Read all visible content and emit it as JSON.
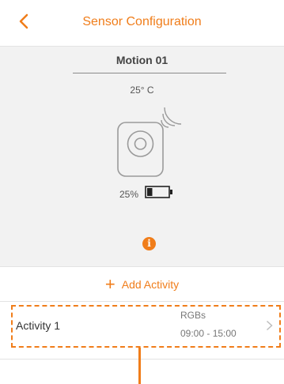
{
  "header": {
    "title": "Sensor Configuration",
    "back_icon": "chevron-left-icon"
  },
  "sensor": {
    "name": "Motion 01",
    "temperature": "25° C",
    "battery_text": "25%",
    "battery_level": 0.25,
    "icons": [
      "motion-sensor-icon",
      "signal-waves-icon",
      "battery-icon",
      "info-icon"
    ]
  },
  "info_icon_glyph": "i",
  "add_activity": {
    "plus": "+",
    "label": "Add Activity"
  },
  "activities": [
    {
      "name": "Activity 1",
      "type": "RGBs",
      "time": "09:00 - 15:00"
    }
  ],
  "colors": {
    "accent": "#f07d1a",
    "background": "#f2f2f2"
  }
}
